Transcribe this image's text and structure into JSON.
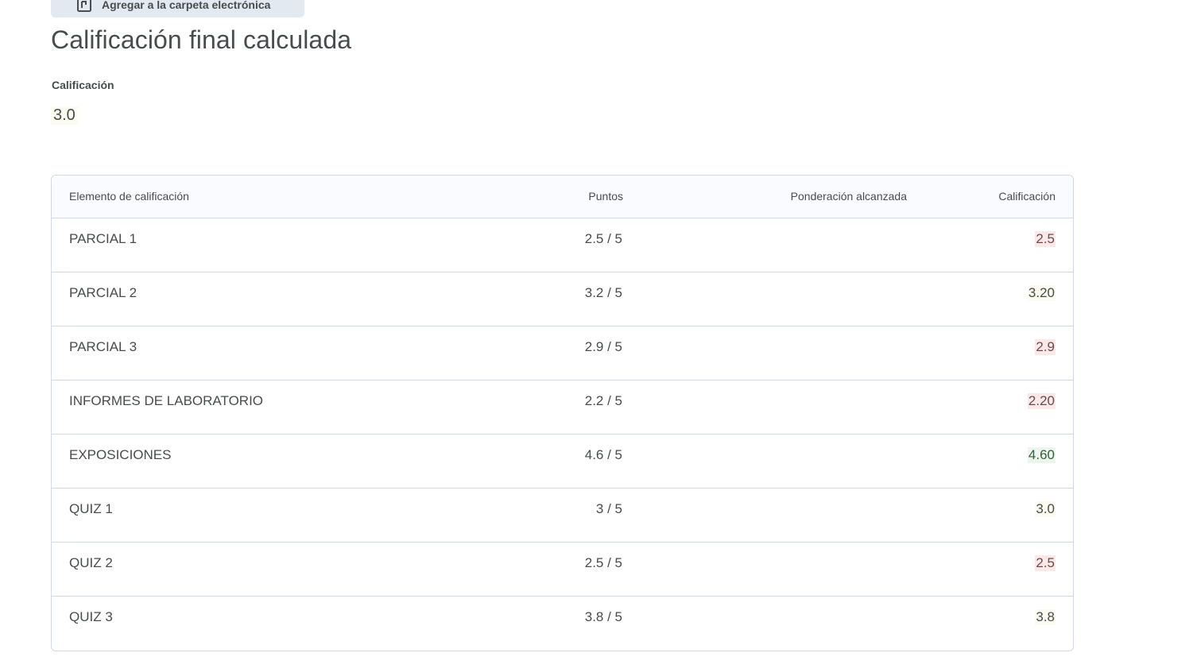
{
  "top_action": {
    "label": "Agregar a la carpeta electrónica",
    "icon": "briefcase-add-icon"
  },
  "page": {
    "title": "Calificación final calculada"
  },
  "final_grade": {
    "label": "Calificación",
    "value": "3.0"
  },
  "table": {
    "headers": {
      "item": "Elemento de calificación",
      "points": "Puntos",
      "weight": "Ponderación alcanzada",
      "grade": "Calificación"
    },
    "rows": [
      {
        "item": "PARCIAL 1",
        "points": "2.5 / 5",
        "weight": "",
        "grade": "2.5",
        "status": "low"
      },
      {
        "item": "PARCIAL 2",
        "points": "3.2 / 5",
        "weight": "",
        "grade": "3.20",
        "status": "mid"
      },
      {
        "item": "PARCIAL 3",
        "points": "2.9 / 5",
        "weight": "",
        "grade": "2.9",
        "status": "low"
      },
      {
        "item": "INFORMES DE LABORATORIO",
        "points": "2.2 / 5",
        "weight": "",
        "grade": "2.20",
        "status": "low"
      },
      {
        "item": "EXPOSICIONES",
        "points": "4.6 / 5",
        "weight": "",
        "grade": "4.60",
        "status": "high"
      },
      {
        "item": "QUIZ 1",
        "points": "3 / 5",
        "weight": "",
        "grade": "3.0",
        "status": "mid"
      },
      {
        "item": "QUIZ 2",
        "points": "2.5 / 5",
        "weight": "",
        "grade": "2.5",
        "status": "low"
      },
      {
        "item": "QUIZ 3",
        "points": "3.8 / 5",
        "weight": "",
        "grade": "3.8",
        "status": "mid"
      }
    ]
  },
  "colors": {
    "low_bg": "#fbe9ea",
    "mid_bg": "#fbfbf2",
    "high_bg": "#ebf6ec",
    "border": "#d3d9e3",
    "button_bg": "#e3e9f1"
  }
}
